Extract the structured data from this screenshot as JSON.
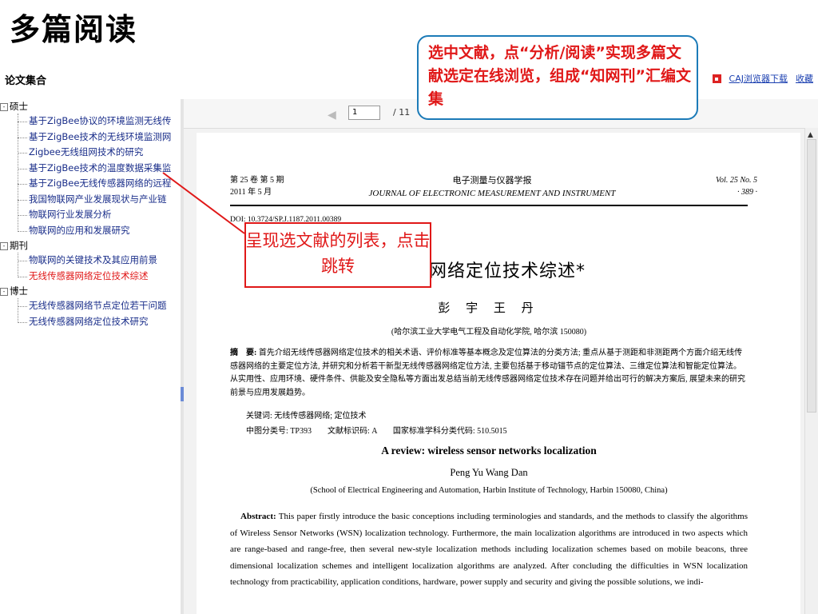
{
  "slide_title": "多篇阅读",
  "header": {
    "collection_title": "论文集合",
    "links": [
      "CAJ浏览器下载",
      "收藏"
    ]
  },
  "sidebar": {
    "groups": [
      {
        "label": "硕士",
        "expander": "-",
        "items": [
          "基于ZigBee协议的环境监测无线传",
          "基于ZigBee技术的无线环境监测网",
          "Zigbee无线组网技术的研究",
          "基于ZigBee技术的温度数据采集监",
          "基于ZigBee无线传感器网络的远程",
          "我国物联网产业发展现状与产业链",
          "物联网行业发展分析",
          "物联网的应用和发展研究"
        ]
      },
      {
        "label": "期刊",
        "expander": "-",
        "items": [
          "物联网的关键技术及其应用前景",
          "无线传感器网络定位技术综述"
        ],
        "active_index": 1
      },
      {
        "label": "博士",
        "expander": "-",
        "items": [
          "无线传感器网络节点定位若干问题",
          "无线传感器网络定位技术研究"
        ]
      }
    ]
  },
  "toolbar": {
    "page_value": "1",
    "page_total": "/ 11"
  },
  "document": {
    "head_left": [
      "第 25 卷  第 5 期",
      "2011 年 5 月"
    ],
    "head_center": [
      "电子测量与仪器学报",
      "JOURNAL OF ELECTRONIC MEASUREMENT AND INSTRUMENT"
    ],
    "head_right": [
      "Vol. 25  No. 5",
      "· 389 ·"
    ],
    "doi": "DOI: 10.3724/SP.J.1187.2011.00389",
    "cn_title": "感器网络定位技术综述*",
    "cn_authors": "彭 宇 王 丹",
    "cn_affil": "(哈尔滨工业大学电气工程及自动化学院, 哈尔滨 150080)",
    "cn_abstract_label": "摘　要:",
    "cn_abstract": "首先介绍无线传感器网络定位技术的相关术语、评价标准等基本概念及定位算法的分类方法; 重点从基于测距和非测距两个方面介绍无线传感器网络的主要定位方法, 并研究和分析若干新型无线传感器网络定位方法, 主要包括基于移动锚节点的定位算法、三维定位算法和智能定位算法。从实用性、应用环境、硬件条件、供能及安全隐私等方面出发总结当前无线传感器网络定位技术存在问题并给出可行的解决方案后, 展望未来的研究前景与应用发展趋势。",
    "cn_keywords": "关键词: 无线传感器网络; 定位技术",
    "cn_class": "中图分类号: TP393　　文献标识码: A　　国家标准学科分类代码: 510.5015",
    "en_title": "A review: wireless sensor networks localization",
    "en_authors": "Peng Yu   Wang Dan",
    "en_affil": "(School of Electrical Engineering and Automation, Harbin Institute of Technology, Harbin 150080, China)",
    "en_abstract_label": "Abstract:",
    "en_abstract": "This paper firstly introduce the basic conceptions including terminologies and standards, and the methods to classify the algorithms of Wireless Sensor Networks (WSN) localization technology. Furthermore, the main localization algorithms are introduced in two aspects which are range-based and range-free, then several new-style localization methods including localization schemes based on mobile beacons, three dimensional localization schemes and intelligent localization algorithms are analyzed. After concluding the difficulties in WSN localization technology from practicability, application conditions, hardware, power supply and security and giving the possible solutions, we indi-"
  },
  "callouts": {
    "blue": "选中文献，点“分析/阅读”实现多篇文献选定在线浏览，组成“知网刊”汇编文集",
    "red": "呈现选文献的列表，点击跳转"
  },
  "colors": {
    "accent_red": "#e01818",
    "link_blue": "#1a2e8a",
    "callout_border": "#1c7bb8"
  }
}
